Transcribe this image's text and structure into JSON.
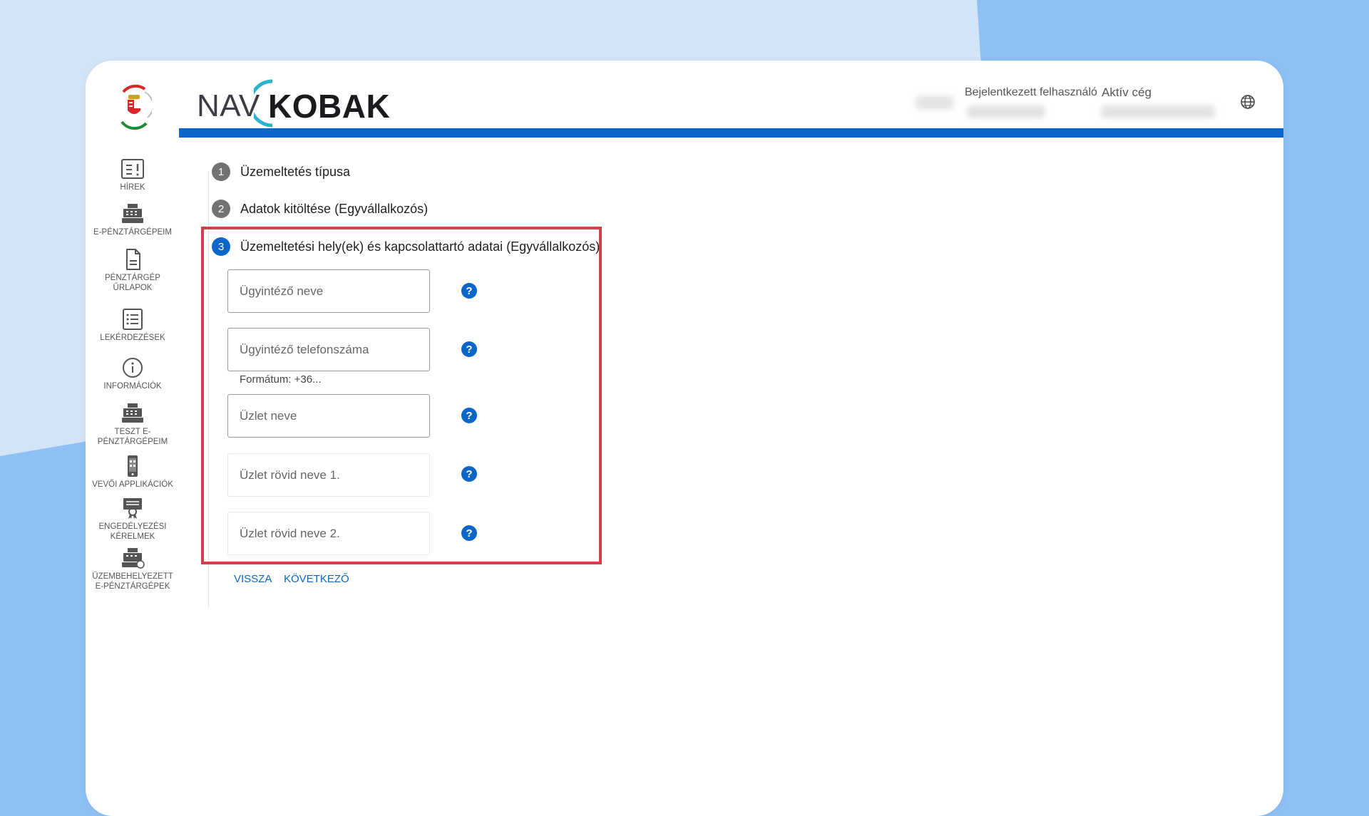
{
  "brand": {
    "nav": "NAV",
    "kobak": "KOBAK"
  },
  "header": {
    "user_label": "Bejelentkezett felhasználó",
    "company_label": "Aktív cég"
  },
  "sidebar": {
    "items": [
      {
        "label": "HÍREK",
        "icon": "news-icon"
      },
      {
        "label": "E-PÉNZTÁRGÉPEIM",
        "icon": "cash-register-icon"
      },
      {
        "label": "PÉNZTÁRGÉP ŰRLAPOK",
        "icon": "document-icon"
      },
      {
        "label": "LEKÉRDEZÉSEK",
        "icon": "list-icon"
      },
      {
        "label": "INFORMÁCIÓK",
        "icon": "info-icon"
      },
      {
        "label": "TESZT E-PÉNZTÁRGÉPEIM",
        "icon": "cash-register-icon"
      },
      {
        "label": "VEVŐI APPLIKÁCIÓK",
        "icon": "phone-icon"
      },
      {
        "label": "ENGEDÉLYEZÉSI KÉRELMEK",
        "icon": "certificate-icon"
      },
      {
        "label": "ÜZEMBEHELYEZETT E-PÉNZTÁRGÉPEK",
        "icon": "cash-register-check-icon"
      }
    ]
  },
  "steps": [
    {
      "num": "1",
      "title": "Üzemeltetés típusa"
    },
    {
      "num": "2",
      "title": "Adatok kitöltése (Egyvállalkozós)"
    },
    {
      "num": "3",
      "title": "Üzemeltetési hely(ek) és kapcsolattartó adatai (Egyvállalkozós)"
    }
  ],
  "form": {
    "fields": [
      {
        "placeholder": "Ügyintéző neve",
        "value": ""
      },
      {
        "placeholder": "Ügyintéző telefonszáma",
        "value": ""
      },
      {
        "placeholder": "Üzlet neve",
        "value": ""
      },
      {
        "placeholder": "Üzlet rövid neve 1.",
        "value": ""
      },
      {
        "placeholder": "Üzlet rövid neve 2.",
        "value": ""
      }
    ],
    "phone_hint": "Formátum: +36...",
    "help_glyph": "?"
  },
  "actions": {
    "back": "VISSZA",
    "next": "KÖVETKEZŐ"
  },
  "colors": {
    "accent": "#0a66c9",
    "highlight": "#cf3f4c",
    "background": "#8ec0f6"
  }
}
